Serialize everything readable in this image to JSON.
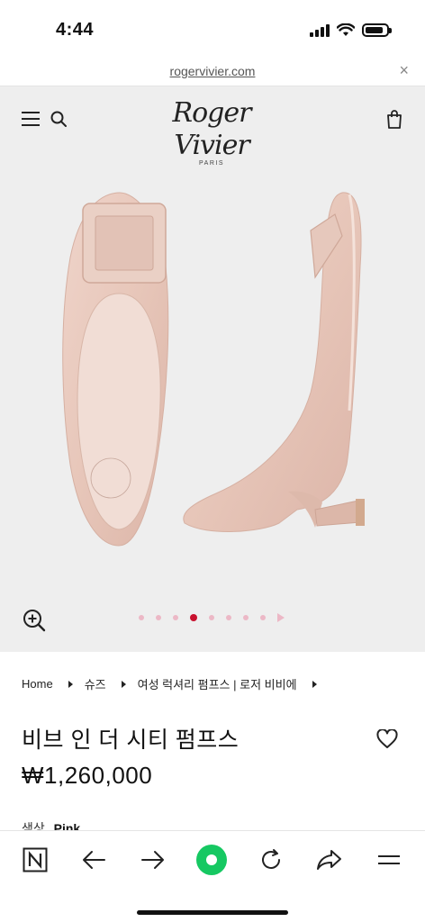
{
  "status_bar": {
    "time": "4:44"
  },
  "browser": {
    "url": "rogervivier.com",
    "close_symbol": "×"
  },
  "header": {
    "brand_name": "Roger Vivier",
    "brand_sub": "PARIS"
  },
  "gallery": {
    "total_images": 8,
    "active_index": 3
  },
  "breadcrumb": [
    "Home",
    "슈즈",
    "여성 럭셔리 펌프스 | 로저 비비에"
  ],
  "product": {
    "title": "비브 인 더 시티 펌프스",
    "price": "₩1,260,000",
    "color_label": "색상",
    "color_value": "Pink"
  },
  "colors": {
    "accent": "#c8102e",
    "dot_inactive": "#ecb8c6",
    "toolbar_green": "#16c862",
    "gallery_bg": "#eeeeee",
    "shoe": "#e9cbbf"
  },
  "toolbar": {
    "items": [
      "naver-icon",
      "back-arrow-icon",
      "forward-arrow-icon",
      "green-dot-icon",
      "refresh-icon",
      "share-icon",
      "menu-icon"
    ]
  }
}
